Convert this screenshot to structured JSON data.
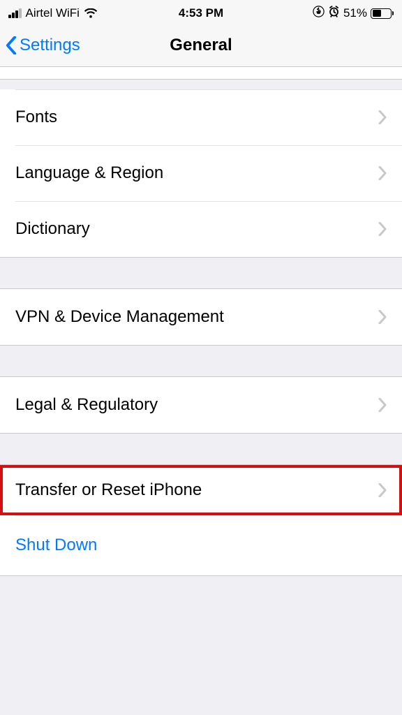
{
  "statusBar": {
    "carrier": "Airtel WiFi",
    "time": "4:53 PM",
    "batteryPercent": "51%"
  },
  "nav": {
    "back": "Settings",
    "title": "General"
  },
  "groups": {
    "g1": {
      "fonts": "Fonts",
      "language": "Language & Region",
      "dictionary": "Dictionary"
    },
    "g2": {
      "vpn": "VPN & Device Management"
    },
    "g3": {
      "legal": "Legal & Regulatory"
    },
    "g4": {
      "transfer": "Transfer or Reset iPhone",
      "shutdown": "Shut Down"
    }
  }
}
